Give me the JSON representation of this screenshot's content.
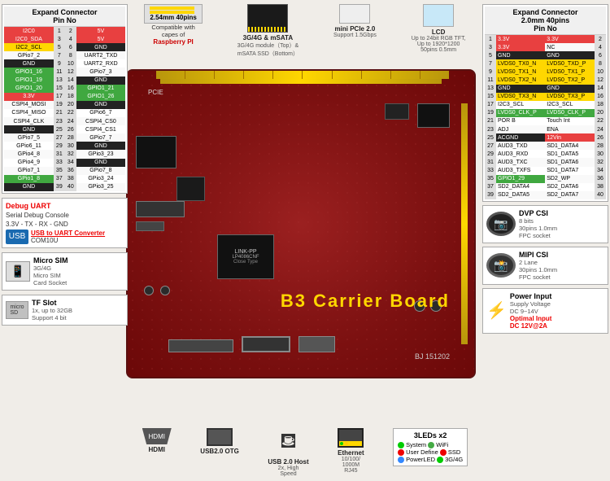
{
  "page": {
    "title": "B3 Carrier Board",
    "board_id": "BJ 151202"
  },
  "left_connector": {
    "title": "Expand Connector",
    "subtitle": "Pin No",
    "header_cols": [
      "",
      "Pin",
      "Pin",
      ""
    ],
    "pins": [
      {
        "left_label": "I2C0",
        "left_color": "red",
        "pin_l": 1,
        "pin_r": 2,
        "right_label": "5V",
        "right_color": "red"
      },
      {
        "left_label": "I2C0_SDA",
        "left_color": "red",
        "pin_l": 3,
        "pin_r": 4,
        "right_label": "5V",
        "right_color": "red"
      },
      {
        "left_label": "I2C2_SCL",
        "left_color": "yellow",
        "pin_l": 5,
        "pin_r": 6,
        "right_label": "GND",
        "right_color": "black"
      },
      {
        "left_label": "GPio7_2",
        "left_color": "",
        "pin_l": 7,
        "pin_r": 8,
        "right_label": "UART2_TXD",
        "right_color": ""
      },
      {
        "left_label": "GND",
        "left_color": "black",
        "pin_l": 9,
        "pin_r": 10,
        "right_label": "UART2_RXD",
        "right_color": ""
      },
      {
        "left_label": "GPIO1_16",
        "left_color": "green",
        "pin_l": 11,
        "pin_r": 12,
        "right_label": "GPio7_3",
        "right_color": ""
      },
      {
        "left_label": "GPIO1_19",
        "left_color": "green",
        "pin_l": 13,
        "pin_r": 14,
        "right_label": "GND",
        "right_color": "black"
      },
      {
        "left_label": "GPIO1_20",
        "left_color": "green",
        "pin_l": 15,
        "pin_r": 16,
        "right_label": "GPIO1_21",
        "right_color": "green"
      },
      {
        "left_label": "3.3V",
        "left_color": "red",
        "pin_l": 17,
        "pin_r": 18,
        "right_label": "GPIO1_26",
        "right_color": "green"
      },
      {
        "left_label": "CSPI4_MOSI",
        "left_color": "",
        "pin_l": 19,
        "pin_r": 20,
        "right_label": "GND",
        "right_color": "black"
      },
      {
        "left_label": "CSPI4_MISO",
        "left_color": "",
        "pin_l": 21,
        "pin_r": 22,
        "right_label": "GPio6_7",
        "right_color": ""
      },
      {
        "left_label": "CSPI4_CLK",
        "left_color": "",
        "pin_l": 23,
        "pin_r": 24,
        "right_label": "CSPI4_CS0",
        "right_color": ""
      },
      {
        "left_label": "GND",
        "left_color": "black",
        "pin_l": 25,
        "pin_r": 26,
        "right_label": "CSPI4_CS1",
        "right_color": ""
      },
      {
        "left_label": "GPio7_5",
        "left_color": "",
        "pin_l": 27,
        "pin_r": 28,
        "right_label": "GPio7_7",
        "right_color": ""
      },
      {
        "left_label": "GPio6_11",
        "left_color": "",
        "pin_l": 29,
        "pin_r": 30,
        "right_label": "GND",
        "right_color": "black"
      },
      {
        "left_label": "GPio4_8",
        "left_color": "",
        "pin_l": 31,
        "pin_r": 32,
        "right_label": "GPio3_23",
        "right_color": ""
      },
      {
        "left_label": "GPio4_9",
        "left_color": "",
        "pin_l": 33,
        "pin_r": 34,
        "right_label": "GND",
        "right_color": "black"
      },
      {
        "left_label": "GPio7_1",
        "left_color": "",
        "pin_l": 35,
        "pin_r": 36,
        "right_label": "GPio7_8",
        "right_color": ""
      },
      {
        "left_label": "GPio1_8",
        "left_color": "green",
        "pin_l": 37,
        "pin_r": 38,
        "right_label": "GPio3_24",
        "right_color": ""
      },
      {
        "left_label": "GND",
        "left_color": "black",
        "pin_l": 39,
        "pin_r": 40,
        "right_label": "GPio3_25",
        "right_color": ""
      }
    ]
  },
  "right_connector": {
    "title": "Expand Connector",
    "subtitle_top": "2.0mm 40pins",
    "subtitle_pin": "Pin No",
    "pins": [
      {
        "pin_l": 1,
        "pin_r": 2,
        "left_label": "3.3V",
        "right_label": "3.3V",
        "left_color": "red",
        "right_color": "red"
      },
      {
        "pin_l": 3,
        "pin_r": 4,
        "left_label": "3.3V",
        "right_label": "NC",
        "left_color": "red",
        "right_color": ""
      },
      {
        "pin_l": 5,
        "pin_r": 6,
        "left_label": "GND",
        "right_label": "GND",
        "left_color": "black",
        "right_color": "black"
      },
      {
        "pin_l": 7,
        "pin_r": 8,
        "left_label": "LVDS0_TX0_N",
        "right_label": "LVDS0_TXD_P",
        "left_color": "yellow",
        "right_color": "yellow"
      },
      {
        "pin_l": 9,
        "pin_r": 10,
        "left_label": "LVDS0_TX1_N",
        "right_label": "LVDS0_TX1_P",
        "left_color": "yellow",
        "right_color": "yellow"
      },
      {
        "pin_l": 11,
        "pin_r": 12,
        "left_label": "LVDS0_TX2_N",
        "right_label": "LVDS0_TX2_P",
        "left_color": "yellow",
        "right_color": "yellow"
      },
      {
        "pin_l": 13,
        "pin_r": 14,
        "left_label": "GND",
        "right_label": "GND",
        "left_color": "black",
        "right_color": "black"
      },
      {
        "pin_l": 15,
        "pin_r": 16,
        "left_label": "LVDS0_TX3_N",
        "right_label": "LVDS0_TX3_P",
        "left_color": "yellow",
        "right_color": "yellow"
      },
      {
        "pin_l": 17,
        "pin_r": 18,
        "left_label": "I2C3_SCL",
        "right_label": "I2C3_SCL",
        "left_color": "",
        "right_color": ""
      },
      {
        "pin_l": 19,
        "pin_r": 20,
        "left_label": "LVDS0_CLK_P",
        "right_label": "LVDS0_CLK_P",
        "left_color": "green",
        "right_color": "green"
      },
      {
        "pin_l": 21,
        "pin_r": 22,
        "left_label": "POR B",
        "right_label": "Touch Int",
        "left_color": "",
        "right_color": ""
      },
      {
        "pin_l": 23,
        "pin_r": 24,
        "left_label": "ADJ",
        "right_label": "ENA",
        "left_color": "",
        "right_color": ""
      },
      {
        "pin_l": 25,
        "pin_r": 26,
        "left_label": "ACGND",
        "right_label": "12Vin",
        "left_color": "black",
        "right_color": "red"
      },
      {
        "pin_l": 27,
        "pin_r": 28,
        "left_label": "AUD3_TXD",
        "right_label": "SD1_DATA4",
        "left_color": "",
        "right_color": ""
      },
      {
        "pin_l": 29,
        "pin_r": 30,
        "left_label": "AUD3_RXD",
        "right_label": "SD1_DATA5",
        "left_color": "",
        "right_color": ""
      },
      {
        "pin_l": 31,
        "pin_r": 32,
        "left_label": "AUD3_TXC",
        "right_label": "SD1_DATA6",
        "left_color": "",
        "right_color": ""
      },
      {
        "pin_l": 33,
        "pin_r": 34,
        "left_label": "AUD3_TXFS",
        "right_label": "SD1_DATA7",
        "left_color": "",
        "right_color": ""
      },
      {
        "pin_l": 35,
        "pin_r": 36,
        "left_label": "GPIO1_29",
        "right_label": "SD2_WP",
        "left_color": "green",
        "right_color": ""
      },
      {
        "pin_l": 37,
        "pin_r": 38,
        "left_label": "SD2_DATA4",
        "right_label": "SD2_DATA6",
        "left_color": "",
        "right_color": ""
      },
      {
        "pin_l": 39,
        "pin_r": 40,
        "left_label": "SD2_DATA5",
        "right_label": "SD2_DATA7",
        "left_color": "",
        "right_color": ""
      }
    ]
  },
  "top_items": {
    "connector_40pin": {
      "label": "2.54mm 40pins"
    },
    "raspberry_pi": {
      "compat_text": "Compatible with capes of",
      "brand": "Raspberry PI"
    },
    "module_3g": {
      "label": "3G/4G & mSATA",
      "desc1": "3G/4G module（Top）&",
      "desc2": "mSATA SSD（Bottom）"
    },
    "mini_pcie": {
      "label": "mini PCIe 2.0",
      "desc": "Support 1.5Gbps"
    },
    "lcd": {
      "label": "LCD",
      "desc1": "Up to 24bit RGB TFT,",
      "desc2": "Up to 1920*1200",
      "desc3": "50pins 0.5mm"
    }
  },
  "bottom_items": {
    "hdmi": {
      "label": "HDMI"
    },
    "usb_otg": {
      "label": "USB2.0 OTG"
    },
    "usb_host": {
      "label": "USB 2.0 Host",
      "desc1": "2x, High",
      "desc2": "Speed"
    },
    "ethernet": {
      "label": "Ethernet",
      "desc": "10/100/\n1000M\nRJ45"
    },
    "leds": {
      "title": "3LEDs x2",
      "system": "System",
      "wifi": "WiFi",
      "user_define": "User Define",
      "ssd": "SSD",
      "power_led": "PowerLED",
      "g3_4": "3G/4G"
    }
  },
  "right_bottom_items": {
    "dvp_csi": {
      "title": "DVP CSI",
      "desc1": "8 bits",
      "desc2": "30pins 1.0mm",
      "desc3": "FPC socket"
    },
    "mipi_csi": {
      "title": "MIPI CSI",
      "desc1": "2 Lane",
      "desc2": "30pins 1.0mm",
      "desc3": "FPC socket"
    },
    "power_input": {
      "title": "Power Input",
      "desc1": "Supply Voltage",
      "desc2": "DC 9~14V",
      "optimal": "Optimal Input",
      "value": "DC 12V@2A"
    }
  },
  "left_bottom_items": {
    "debug_uart": {
      "title": "Debug UART",
      "desc": "Serial Debug Console",
      "spec": "3.3V - TX - RX - GND",
      "converter": "USB to UART Converter",
      "com": "COM10U"
    },
    "micro_sim": {
      "title": "Micro SIM",
      "desc1": "3G/4G",
      "desc2": "Micro SIM",
      "desc3": "Card Socket"
    },
    "tf_slot": {
      "title": "TF Slot",
      "desc1": "1x, up to 32GB",
      "desc2": "Support 4 bit"
    }
  }
}
